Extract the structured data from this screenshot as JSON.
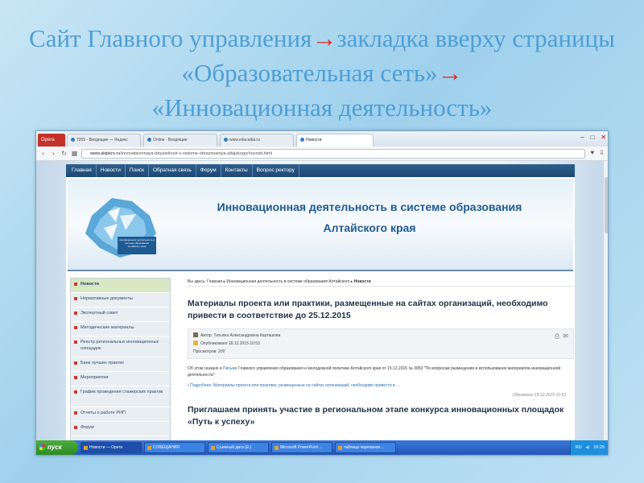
{
  "slide": {
    "title_part1": "Сайт Главного управления",
    "arrow1": "→",
    "title_part2": "закладка вверху страницы «Образовательная сеть»",
    "arrow2": "→",
    "title_part3": "«Инновационная деятельность»"
  },
  "browser": {
    "menu_label": "Opera",
    "tabs": [
      {
        "label": "7255 - Входящие — Яндекс"
      },
      {
        "label": "Online - Входящие"
      },
      {
        "label": "www.educaltai.ru"
      },
      {
        "label": "Новости"
      }
    ],
    "url_prefix": "www.akipkro.ru",
    "url_path": "/innovatsionnaya-deyatelnost-v-sisteme-obrazovaniya-altajskogo/novosti.html"
  },
  "site": {
    "nav": [
      "Главная",
      "Новости",
      "Поиск",
      "Обратная связь",
      "Форум",
      "Контакты",
      "Вопрос ректору"
    ],
    "banner_line1": "Инновационная деятельность в системе образования",
    "banner_line2": "Алтайского края",
    "logo_text": "инновационная деятельность в системе образования Алтайского края",
    "sidebar": [
      {
        "label": "Новости"
      },
      {
        "label": "Нормативные документы"
      },
      {
        "label": "Экспертный совет"
      },
      {
        "label": "Методические материалы"
      },
      {
        "label": "Реестр региональных инновационных площадок"
      },
      {
        "label": "Банк лучших практик"
      },
      {
        "label": "Мероприятия"
      },
      {
        "label": "График проведения стажерских практик"
      },
      {
        "label": "Отчеты о работе РИП"
      },
      {
        "label": "Форум"
      }
    ],
    "breadcrumb": {
      "prefix": "Вы здесь:",
      "items": [
        "Главная",
        "Инновационная деятельность в системе образования Алтайского",
        "Новости"
      ]
    },
    "article1": {
      "title": "Материалы проекта или практики, размещенные на сайтах организаций, необходимо привести в соответствие до 25.12.2015",
      "author": "Автор: Татьяна Александровна Карташова",
      "published": "Опубликовано 18.12.2015 10:53",
      "views": "Просмотров: 200",
      "body_start": "Об этом сказано в",
      "body_link": "Письме",
      "body_rest": "Главного управления образования и молодежной политики Алтайского края от 15.12.2015 № 3053 \"По вопросам размещения и использования материалов инновационной деятельности\"",
      "more": "Подробнее: Материалы проекта или практики, размещенные на сайтах организаций, необходимо привести в ...",
      "updated": "Обновлено 18.12.2015 10:53"
    },
    "article2": {
      "title": "Приглашаем принять участие в региональном этапе конкурса инновационных площадок «Путь к успеху»"
    }
  },
  "taskbar": {
    "start": "пуск",
    "tasks": [
      {
        "label": "Новости — Opera"
      },
      {
        "label": "СОВЕЩАНИЯ"
      },
      {
        "label": "Съемный диск (E:)"
      },
      {
        "label": "Microsoft PowerPoint ..."
      },
      {
        "label": "таблица черепанов ..."
      }
    ],
    "lang": "RU",
    "clock": "16:25"
  }
}
